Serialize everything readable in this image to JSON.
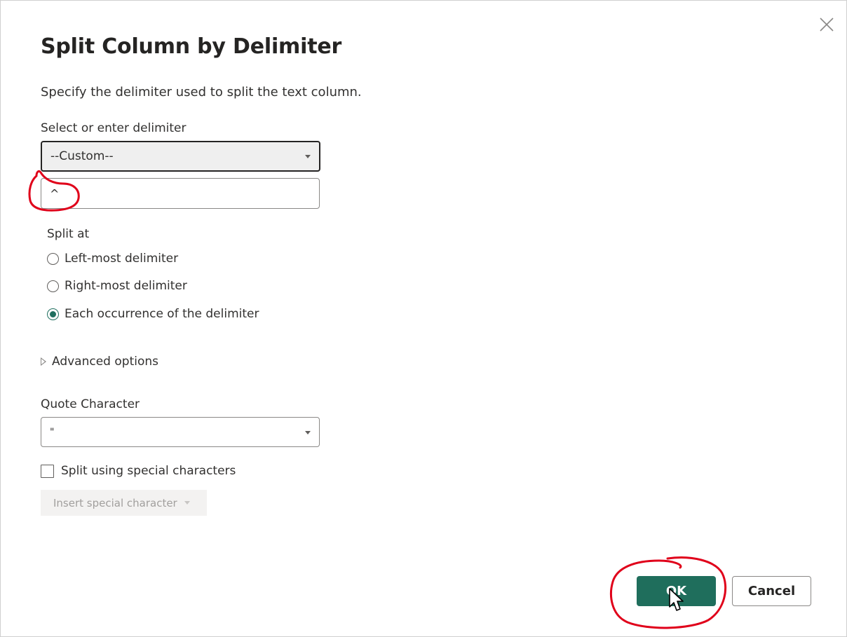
{
  "dialog": {
    "title": "Split Column by Delimiter",
    "description": "Specify the delimiter used to split the text column."
  },
  "delimiter": {
    "label": "Select or enter delimiter",
    "selected": "--Custom--",
    "custom_value": "^"
  },
  "split_at": {
    "label": "Split at",
    "options": [
      {
        "label": "Left-most delimiter",
        "checked": false
      },
      {
        "label": "Right-most delimiter",
        "checked": false
      },
      {
        "label": "Each occurrence of the delimiter",
        "checked": true
      }
    ]
  },
  "advanced": {
    "label": "Advanced options"
  },
  "quote": {
    "label": "Quote Character",
    "selected": "\""
  },
  "special": {
    "checkbox_label": "Split using special characters",
    "checked": false,
    "insert_label": "Insert special character"
  },
  "buttons": {
    "ok": "OK",
    "cancel": "Cancel"
  },
  "colors": {
    "accent": "#1f6e5c",
    "annotation": "#e0001a"
  }
}
